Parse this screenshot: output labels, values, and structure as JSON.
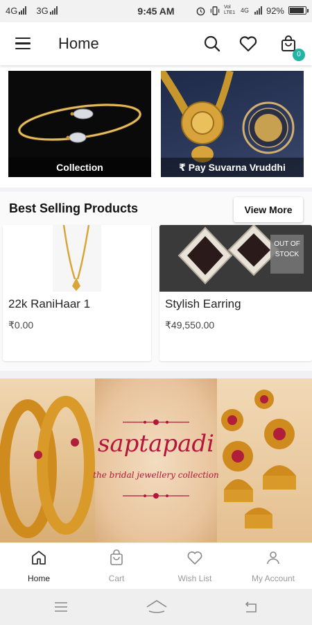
{
  "status_bar": {
    "network_1": "4G",
    "network_2": "3G",
    "time": "9:45 AM",
    "volte": "Vol LTE1",
    "network_3": "4G",
    "battery": "92%",
    "battery_level": 0.92
  },
  "app_bar": {
    "title": "Home",
    "cart_count": "0"
  },
  "banners": [
    {
      "caption": "Collection"
    },
    {
      "caption": "₹ Pay Suvarna Vruddhi"
    }
  ],
  "best_selling": {
    "title": "Best Selling Products",
    "view_more_label": "View More",
    "products": [
      {
        "name": "22k RaniHaar 1",
        "price": "₹0.00"
      },
      {
        "name": "Stylish Earring",
        "price": "₹49,550.00",
        "badge": "OUT OF STOCK"
      }
    ]
  },
  "promo": {
    "title": "saptapadi",
    "subtitle": "the bridal jewellery collection"
  },
  "bottom_nav": [
    {
      "label": "Home",
      "icon": "home-icon",
      "active": true
    },
    {
      "label": "Cart",
      "icon": "bag-icon",
      "active": false
    },
    {
      "label": "Wish List",
      "icon": "heart-icon",
      "active": false
    },
    {
      "label": "My Account",
      "icon": "user-icon",
      "active": false
    }
  ],
  "colors": {
    "accent": "#21b3a3",
    "promo_text": "#b3163a"
  }
}
